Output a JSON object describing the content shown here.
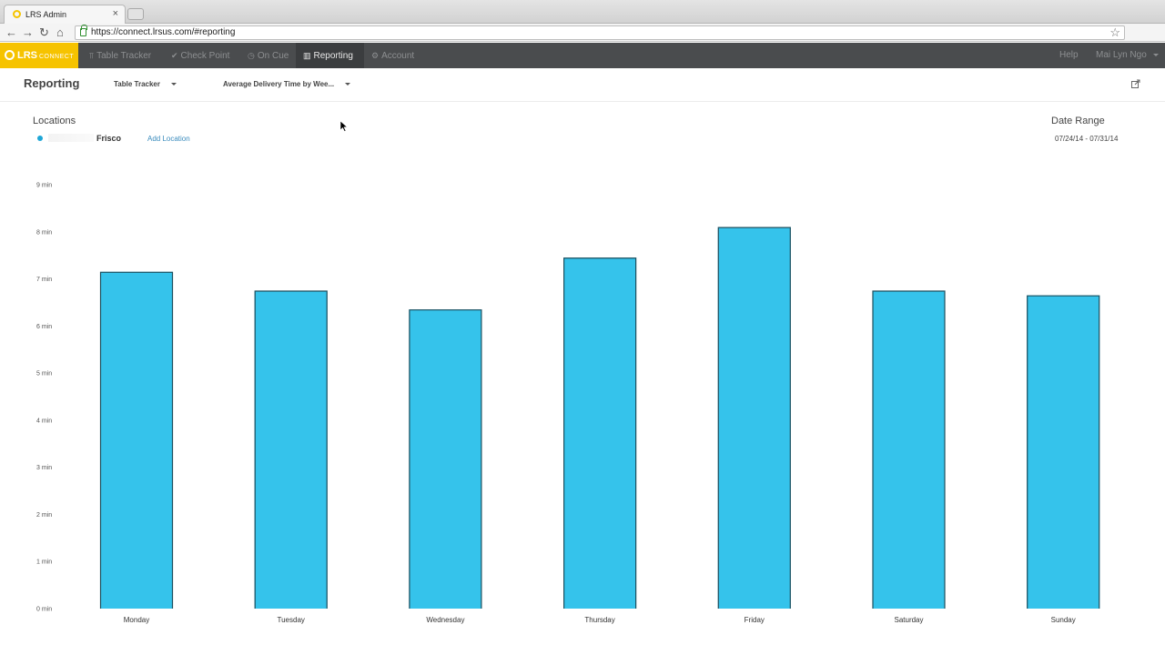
{
  "browser": {
    "tab_title": "LRS Admin",
    "tab_close": "×",
    "url": "https://connect.lrsus.com/#reporting",
    "back": "←",
    "forward": "→",
    "reload": "↻",
    "home": "⌂",
    "star": "☆"
  },
  "appnav": {
    "logo_text": "LRS",
    "logo_sub": "CONNECT",
    "items": [
      {
        "label": "Table Tracker",
        "icon": "table-icon",
        "glyph": "⫪"
      },
      {
        "label": "Check Point",
        "icon": "check-icon",
        "glyph": "✔"
      },
      {
        "label": "On Cue",
        "icon": "clock-icon",
        "glyph": "◷"
      },
      {
        "label": "Reporting",
        "icon": "bar-chart-icon",
        "glyph": "▥"
      },
      {
        "label": "Account",
        "icon": "gear-icon",
        "glyph": "⚙"
      }
    ],
    "help": "Help",
    "user": "Mai Lyn Ngo"
  },
  "subheader": {
    "title": "Reporting",
    "product_select": "Table Tracker",
    "report_select": "Average Delivery Time by Wee..."
  },
  "filters": {
    "locations_label": "Locations",
    "location": "Frisco",
    "add_location": "Add Location",
    "date_range_label": "Date Range",
    "date_range": "07/24/14 - 07/31/14"
  },
  "colors": {
    "bar": "#35c3eb",
    "bar_edge": "#1e4f5e",
    "accent": "#f6c300",
    "nav_bg": "#4a4c4e"
  },
  "chart_data": {
    "type": "bar",
    "categories": [
      "Monday",
      "Tuesday",
      "Wednesday",
      "Thursday",
      "Friday",
      "Saturday",
      "Sunday"
    ],
    "values": [
      7.15,
      6.75,
      6.35,
      7.45,
      8.1,
      6.75,
      6.65
    ],
    "yticks": [
      "0 min",
      "1 min",
      "2 min",
      "3 min",
      "4 min",
      "5 min",
      "6 min",
      "7 min",
      "8 min",
      "9 min"
    ],
    "ylim": [
      0,
      9
    ],
    "grid": false,
    "title": "",
    "xlabel": "",
    "ylabel": ""
  }
}
